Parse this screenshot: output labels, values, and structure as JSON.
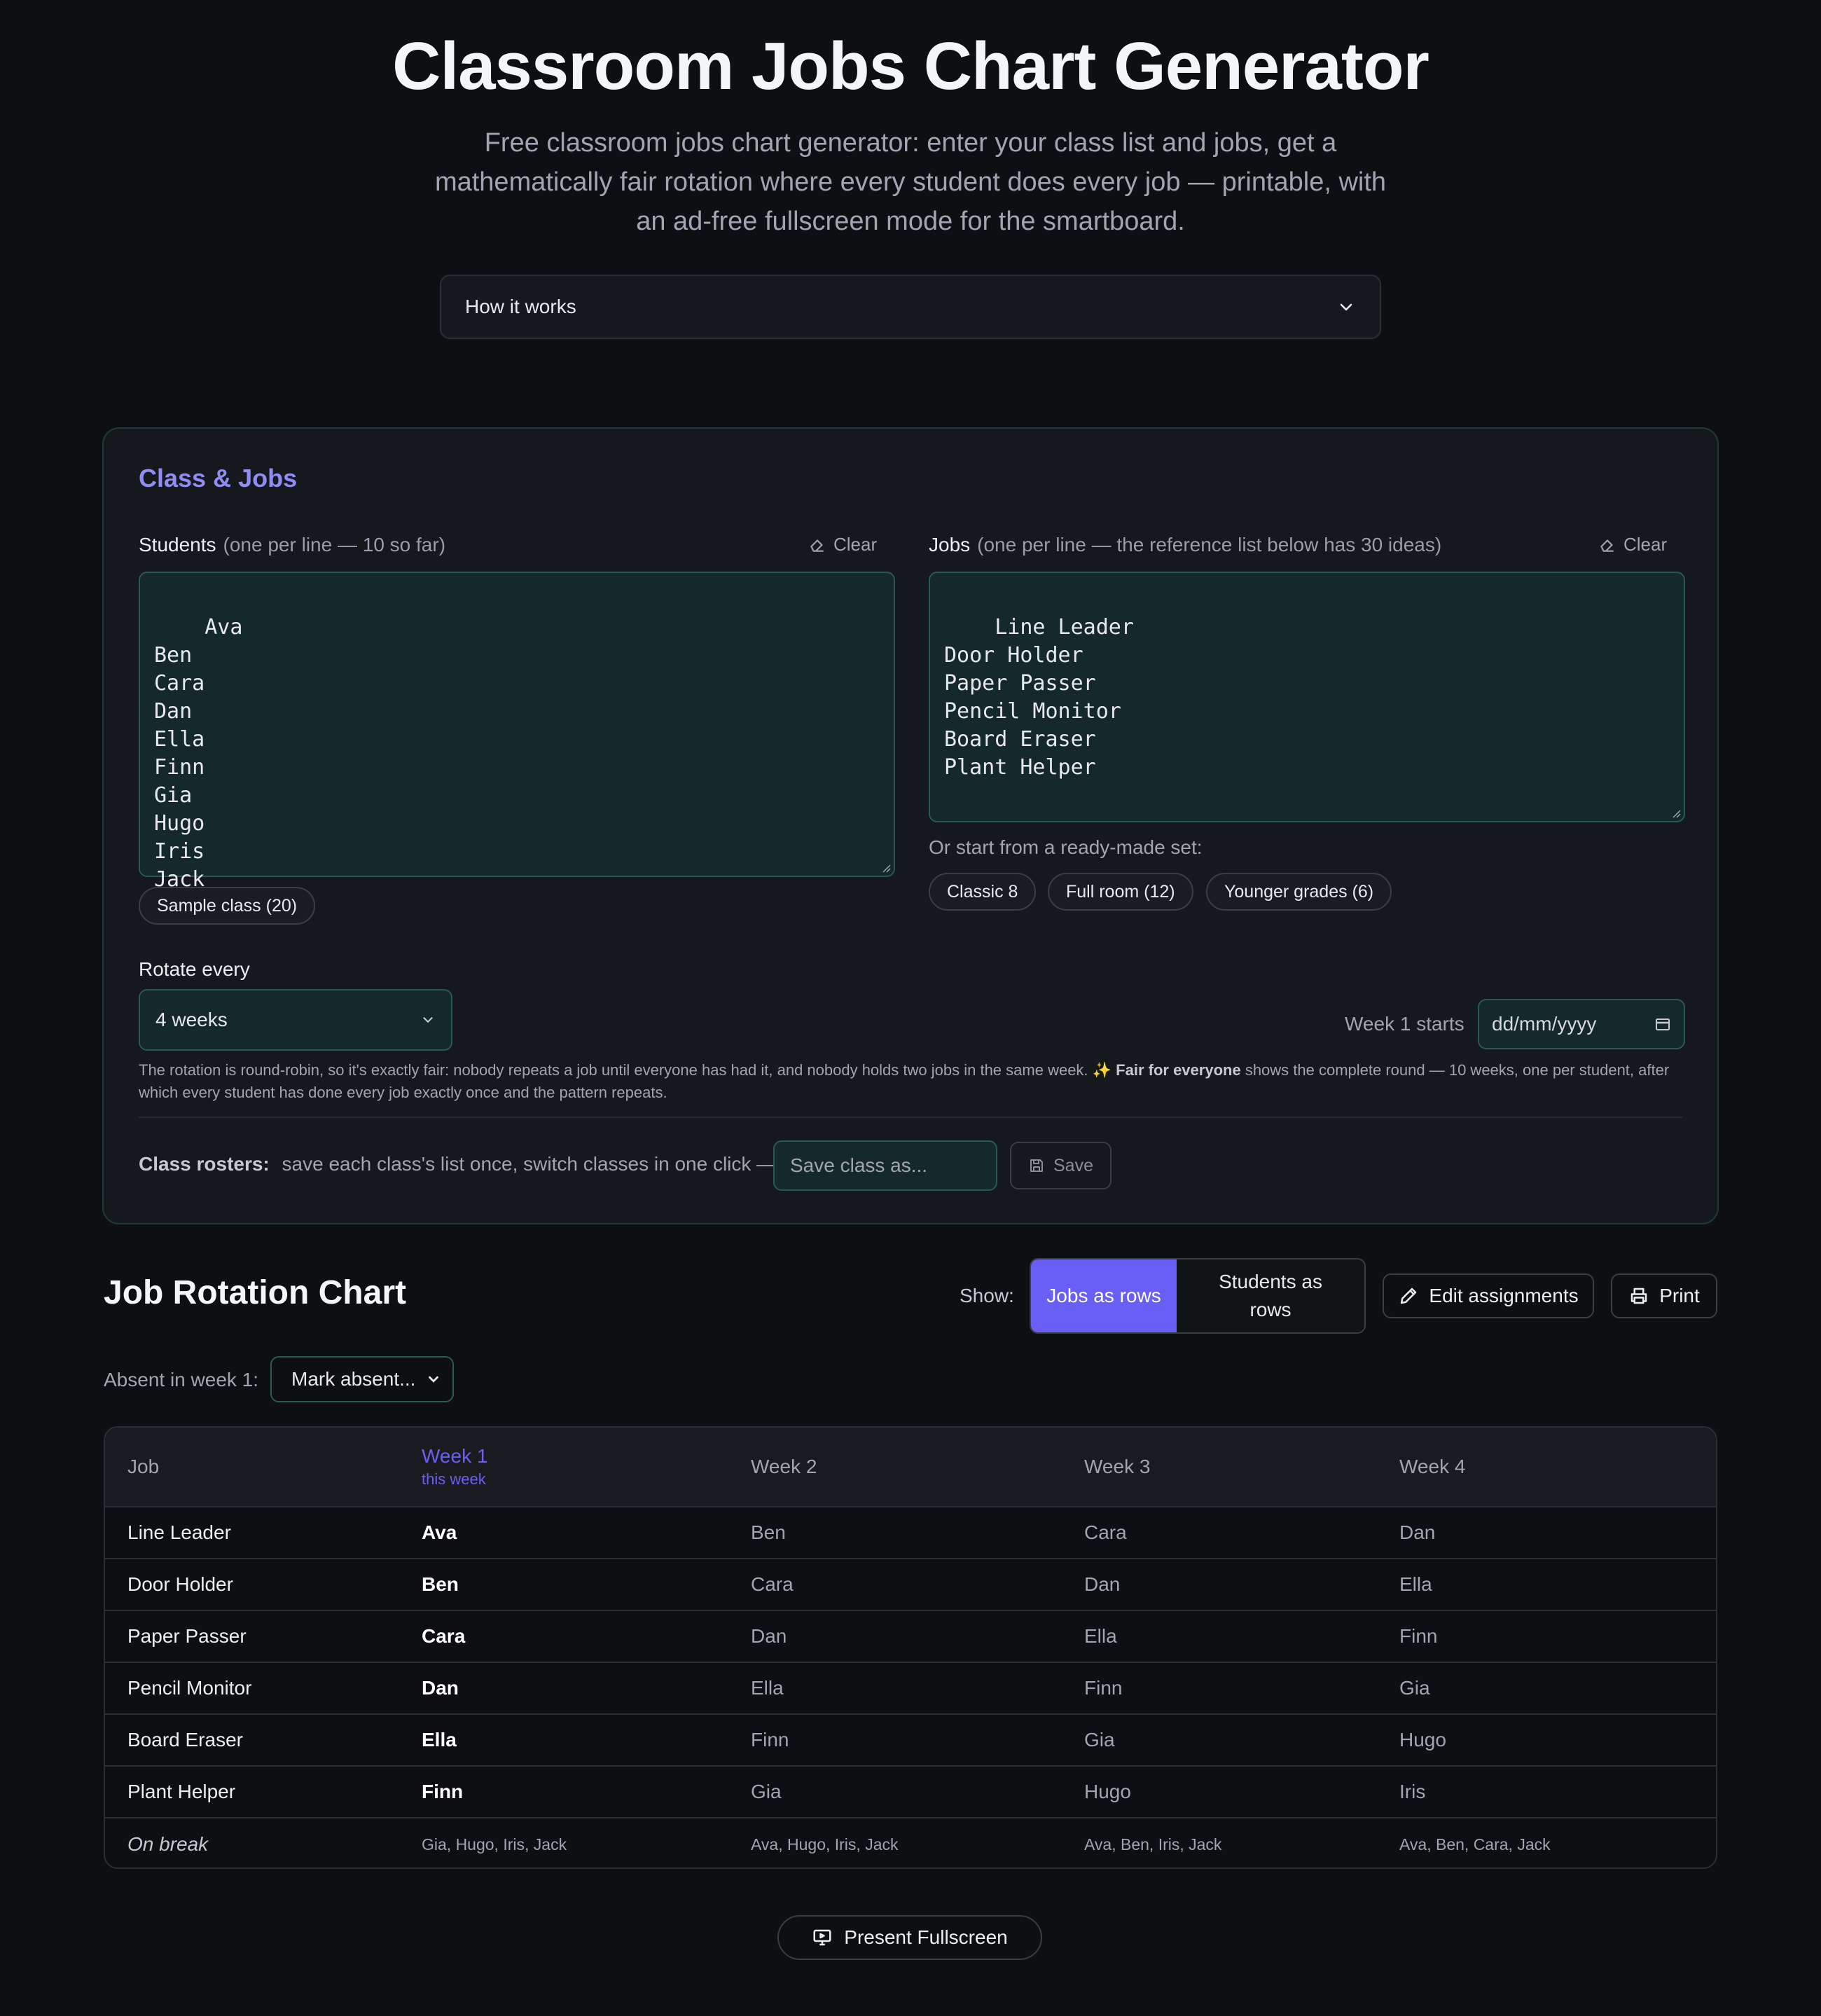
{
  "header": {
    "title": "Classroom Jobs Chart Generator",
    "subtitle": "Free classroom jobs chart generator: enter your class list and jobs, get a mathematically fair rotation where every student does every job — printable, with an ad-free fullscreen mode for the smartboard."
  },
  "how_it_works": {
    "label": "How it works",
    "icon": "chevron-down-icon"
  },
  "panel": {
    "title": "Class & Jobs",
    "students": {
      "label": "Students",
      "hint": "(one per line — 10 so far)",
      "clear_label": "Clear",
      "value": "Ava\nBen\nCara\nDan\nElla\nFinn\nGia\nHugo\nIris\nJack",
      "sample_button": "Sample class (20)"
    },
    "jobs": {
      "label": "Jobs",
      "hint": "(one per line — the reference list below has 30 ideas)",
      "clear_label": "Clear",
      "value": "Line Leader\nDoor Holder\nPaper Passer\nPencil Monitor\nBoard Eraser\nPlant Helper",
      "presets_label": "Or start from a ready-made set:",
      "presets": [
        "Classic 8",
        "Full room (12)",
        "Younger grades (6)"
      ]
    },
    "rotate": {
      "label": "Rotate every",
      "value": "4 weeks"
    },
    "week_start": {
      "label": "Week 1 starts",
      "placeholder": "dd/mm/yyyy"
    },
    "note": {
      "text": "The rotation is round-robin, so it's exactly fair: nobody repeats a job until everyone has had it, and nobody holds two jobs in the same week. ✨",
      "bold": "Fair for everyone",
      "tail": "shows the complete round — 10 weeks, one per student, after which every student has done every job exactly once and the pattern repeats."
    },
    "rosters": {
      "label": "Class rosters:",
      "text": "save each class's list once, switch classes in one click —",
      "input_placeholder": "Save class as...",
      "save_label": "Save"
    }
  },
  "chart": {
    "title": "Job Rotation Chart",
    "show_label": "Show:",
    "view_options": [
      "Jobs as rows",
      "Students as rows"
    ],
    "active_view": "Jobs as rows",
    "edit_label": "Edit assignments",
    "print_label": "Print",
    "absent_label": "Absent in week 1:",
    "absent_select": "Mark absent...",
    "columns": [
      "Job",
      "Week 1",
      "Week 2",
      "Week 3",
      "Week 4"
    ],
    "current_week_note": "this week",
    "rows": [
      {
        "job": "Line Leader",
        "weeks": [
          "Ava",
          "Ben",
          "Cara",
          "Dan"
        ]
      },
      {
        "job": "Door Holder",
        "weeks": [
          "Ben",
          "Cara",
          "Dan",
          "Ella"
        ]
      },
      {
        "job": "Paper Passer",
        "weeks": [
          "Cara",
          "Dan",
          "Ella",
          "Finn"
        ]
      },
      {
        "job": "Pencil Monitor",
        "weeks": [
          "Dan",
          "Ella",
          "Finn",
          "Gia"
        ]
      },
      {
        "job": "Board Eraser",
        "weeks": [
          "Ella",
          "Finn",
          "Gia",
          "Hugo"
        ]
      },
      {
        "job": "Plant Helper",
        "weeks": [
          "Finn",
          "Gia",
          "Hugo",
          "Iris"
        ]
      }
    ],
    "break_row": {
      "label": "On break",
      "weeks": [
        "Gia, Hugo, Iris, Jack",
        "Ava, Hugo, Iris, Jack",
        "Ava, Ben, Iris, Jack",
        "Ava, Ben, Cara, Jack"
      ]
    },
    "present_label": "Present Fullscreen"
  },
  "colors": {
    "accent": "#6a5ff5",
    "accent_text": "#8f8cf4",
    "field_bg": "#16292a",
    "field_border": "#2a5a4b",
    "background": "#0e0f13"
  }
}
